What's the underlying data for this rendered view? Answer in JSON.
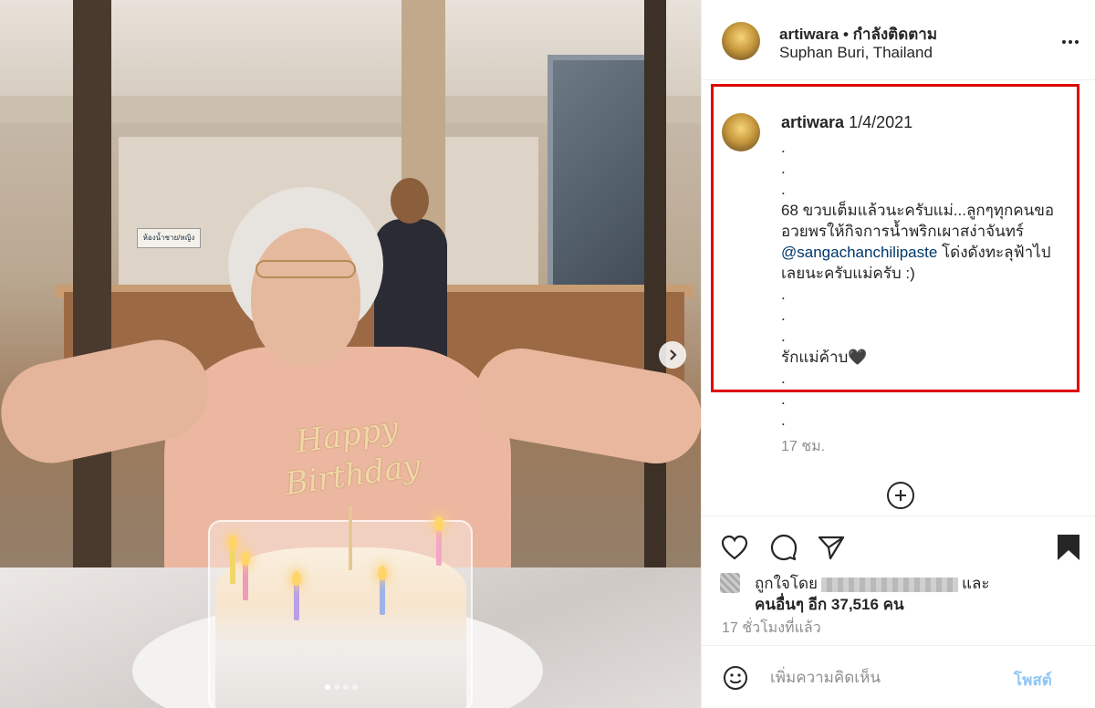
{
  "post": {
    "username": "artiwara",
    "follow_status": "• กำลังติดตาม",
    "location": "Suphan Buri, Thailand"
  },
  "caption": {
    "username": "artiwara",
    "date": "1/4/2021",
    "line1": ".",
    "line2": ".",
    "line3": ".",
    "body_before_mention": "68 ขวบเต็มแล้วนะครับแม่...ลูกๆทุกคนขออวยพรให้กิจการน้ำพริกเผาสง่าจันทร์ ",
    "mention": "@sangachanchilipaste",
    "body_after_mention": " โด่งดังทะลุฟ้าไปเลยนะครับแม่ครับ :)",
    "line5": ".",
    "line6": ".",
    "line7": ".",
    "closing": "รักแม่ค้าบ🖤",
    "line9": ".",
    "line10": ".",
    "line11": ".",
    "time_ago": "17 ชม."
  },
  "photo": {
    "topper_text": "Happy Birthday",
    "sign_text": "ห้องน้ำชาย/หญิง",
    "carousel_pages": 4,
    "carousel_active": 1
  },
  "likes": {
    "prefix": "ถูกใจโดย",
    "conjunction": "และ",
    "others": "คนอื่นๆ อีก 37,516 คน"
  },
  "timestamp": "17 ชั่วโมงที่แล้ว",
  "comment": {
    "placeholder": "เพิ่มความคิดเห็น",
    "post_label": "โพสต์"
  },
  "icons": {
    "more": "more-options-icon",
    "like": "heart-icon",
    "comment": "comment-icon",
    "share": "share-icon",
    "save": "bookmark-icon",
    "emoji": "emoji-icon",
    "next": "chevron-right-icon",
    "load_more": "plus-circle-icon"
  },
  "colors": {
    "highlight_border": "#e00000",
    "mention": "#00376b",
    "post_button": "#8fc6f5",
    "muted_text": "#8e8e8e"
  }
}
